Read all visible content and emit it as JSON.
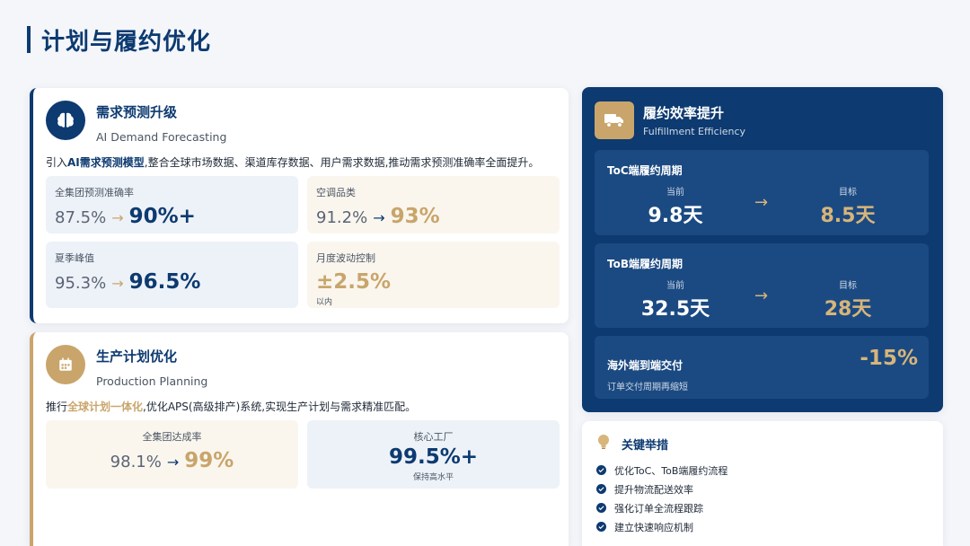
{
  "page": {
    "title": "计划与履约优化"
  },
  "demand": {
    "title": "需求预测升级",
    "subtitle": "AI Demand Forecasting",
    "desc_prefix": "引入",
    "desc_highlight": "AI需求预测模型",
    "desc_suffix": ",整合全球市场数据、渠道库存数据、用户需求数据,推动需求预测准确率全面提升。",
    "metrics": [
      {
        "label": "全集团预测准确率",
        "from": "87.5%",
        "arrow": "→",
        "to": "90%+"
      },
      {
        "label": "空调品类",
        "from": "91.2%",
        "arrow": "→",
        "to": "93%"
      },
      {
        "label": "夏季峰值",
        "from": "95.3%",
        "arrow": "→",
        "to": "96.5%"
      },
      {
        "label": "月度波动控制",
        "value": "±2.5%",
        "note": "以内"
      }
    ]
  },
  "production": {
    "title": "生产计划优化",
    "subtitle": "Production Planning",
    "desc_prefix": "推行",
    "desc_highlight": "全球计划一体化",
    "desc_suffix": ",优化APS(高级排产)系统,实现生产计划与需求精准匹配。",
    "metrics": [
      {
        "label": "全集团达成率",
        "from": "98.1%",
        "arrow": "→",
        "to": "99%"
      },
      {
        "label": "核心工厂",
        "value": "99.5%+",
        "note": "保持高水平"
      }
    ]
  },
  "fulfillment": {
    "title": "履约效率提升",
    "subtitle": "Fulfillment Efficiency",
    "toc": {
      "label": "ToC端履约周期",
      "current_caption": "当前",
      "current": "9.8天",
      "arrow": "→",
      "target_caption": "目标",
      "target": "8.5天"
    },
    "tob": {
      "label": "ToB端履约周期",
      "current_caption": "当前",
      "current": "32.5天",
      "arrow": "→",
      "target_caption": "目标",
      "target": "28天"
    },
    "overseas": {
      "label": "海外端到端交付",
      "note": "订单交付周期再缩短",
      "value": "-15%"
    }
  },
  "measures": {
    "title": "关键举措",
    "items": [
      "优化ToC、ToB端履约流程",
      "提升物流配送效率",
      "强化订单全流程跟踪",
      "建立快速响应机制"
    ]
  },
  "colors": {
    "navy": "#0d3a70",
    "gold": "#c9a56b",
    "light_blue": "#edf2f8",
    "cream": "#faf6ee"
  },
  "icons": [
    "brain-icon",
    "calendar-icon",
    "truck-icon",
    "lightbulb-icon",
    "check-icon",
    "arrow-right-icon"
  ]
}
